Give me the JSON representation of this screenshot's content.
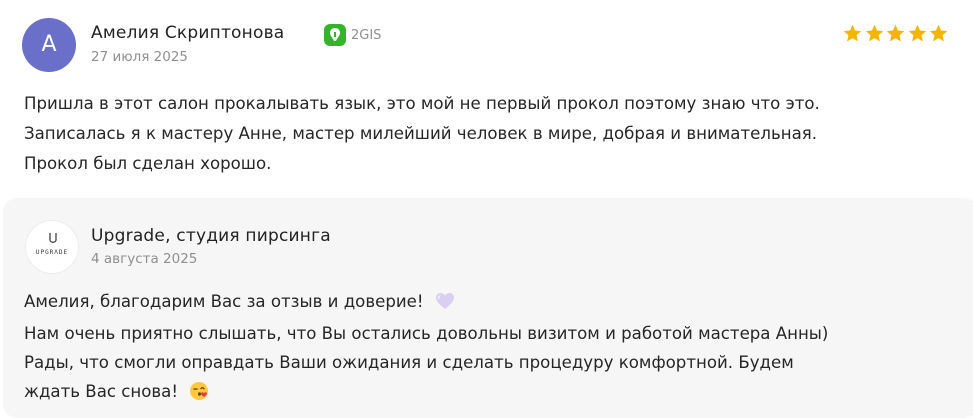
{
  "review": {
    "avatar_letter": "А",
    "author": "Амелия Скриптонова",
    "source_label": "2GIS",
    "date": "27 июля 2025",
    "rating": 5,
    "star_color": "#f5b400",
    "text_lines": [
      "Пришла в этот салон прокалывать язык, это мой не первый прокол поэтому знаю что это.",
      "Записалась я к мастеру Анне, мастер милейший человек в мире, добрая и внимательная.",
      "Прокол был сделан хорошо."
    ]
  },
  "reply": {
    "logo_word": "UPGRΛDE",
    "author": "Upgrade, студия пирсинга",
    "date": "4 августа 2025",
    "text_lines": [
      "Амелия, благодарим Вас за отзыв и доверие!",
      "Нам очень приятно слышать, что Вы остались довольны визитом и работой мастера Анны)",
      "Рады, что смогли оправдать Ваши ожидания и сделать процедуру комфортной. Будем",
      "ждать Вас снова!"
    ]
  },
  "colors": {
    "avatar_bg": "#6a6fc9",
    "source_icon_bg": "#35b32a",
    "reply_bg": "#f6f6f7"
  },
  "icons": {
    "source": "2gis-logo-icon",
    "heart": "lavender-heart-emoji",
    "face": "face-blowing-kiss-emoji"
  }
}
